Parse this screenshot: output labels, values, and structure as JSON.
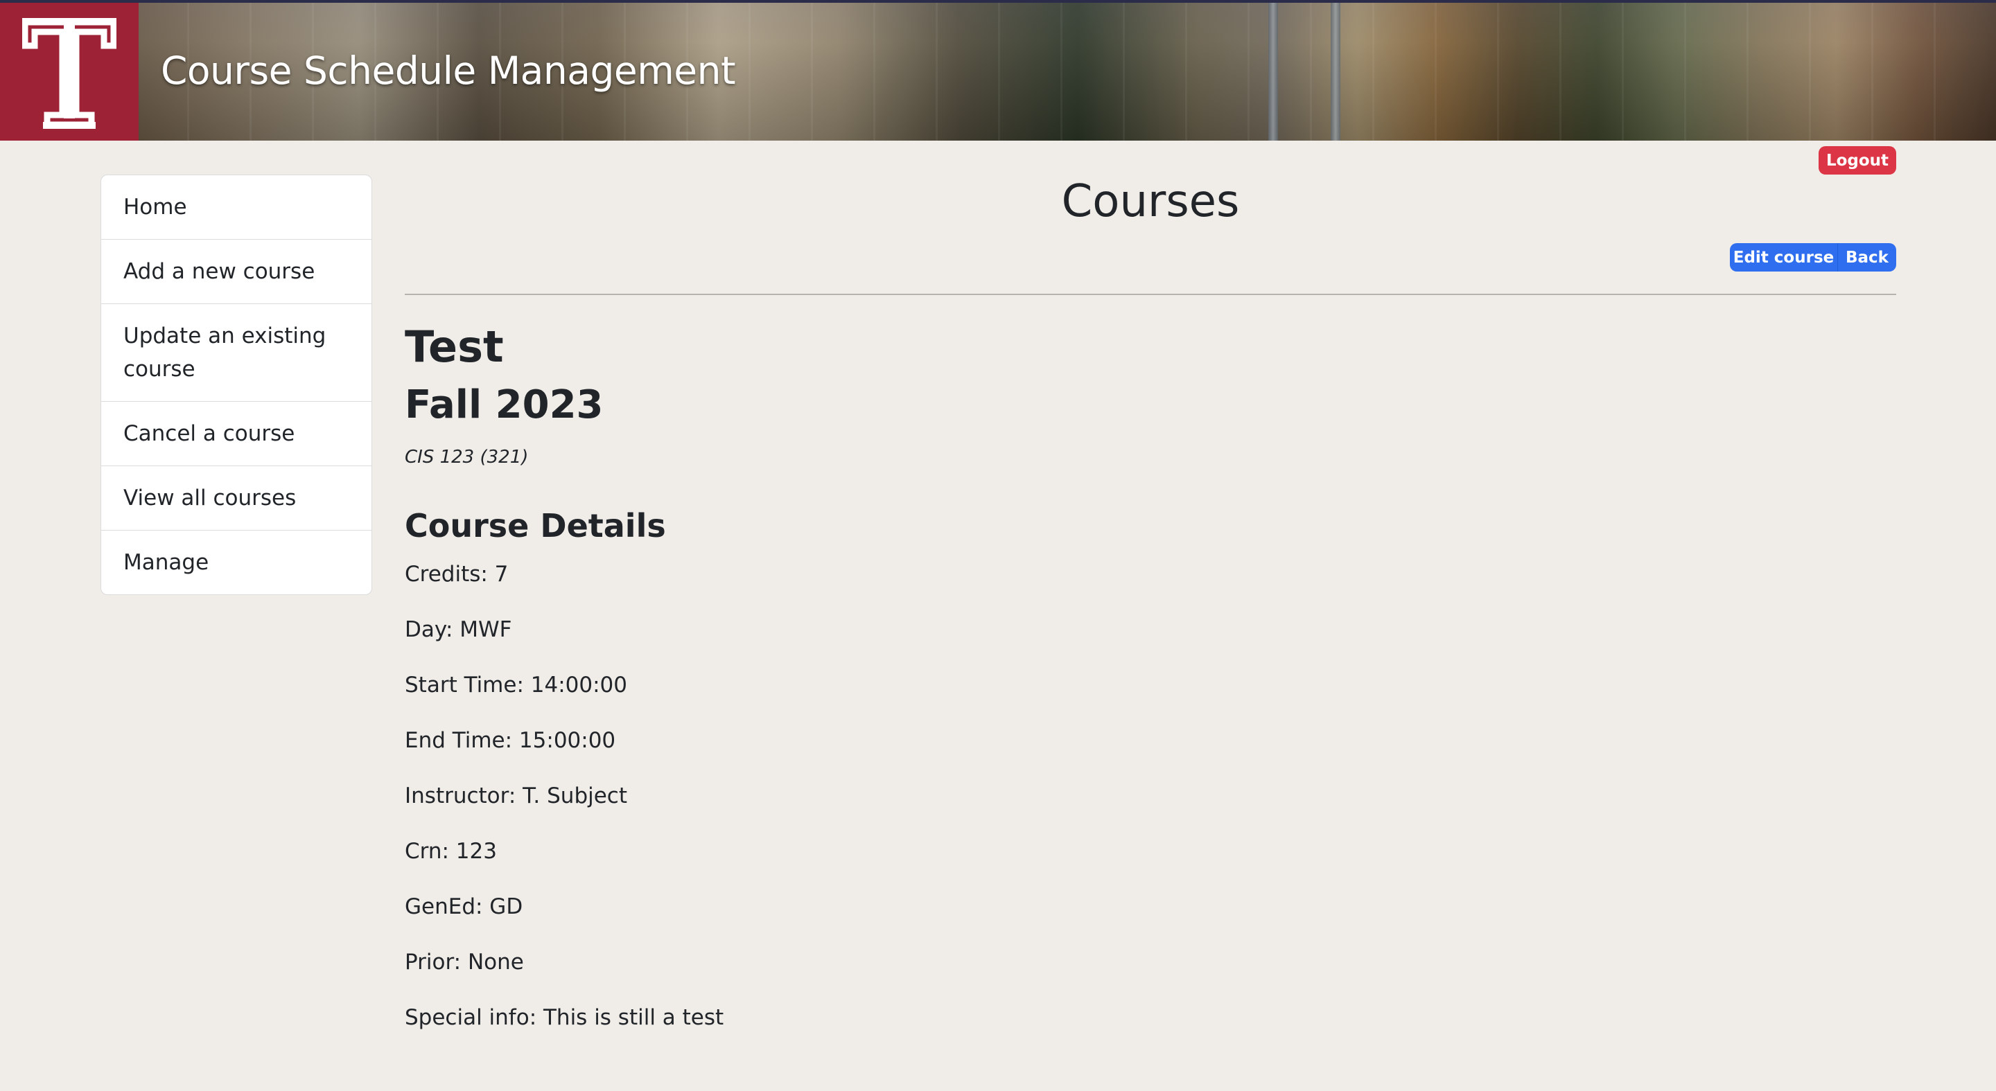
{
  "header": {
    "app_title": "Course Schedule Management",
    "logo_icon": "temple-t-logo-icon",
    "brand_color": "#9d2235"
  },
  "account": {
    "logout_label": "Logout",
    "logout_color": "#dc3545"
  },
  "sidebar": {
    "items": [
      {
        "label": "Home"
      },
      {
        "label": "Add a new course"
      },
      {
        "label": "Update an existing course"
      },
      {
        "label": "Cancel a course"
      },
      {
        "label": "View all courses"
      },
      {
        "label": "Manage"
      }
    ]
  },
  "main": {
    "page_title": "Courses",
    "actions": {
      "edit_label": "Edit course",
      "back_label": "Back",
      "button_color": "#2f6fef"
    },
    "course": {
      "name": "Test",
      "term": "Fall 2023",
      "code": "CIS 123 (321)",
      "details_heading": "Course Details",
      "details": [
        "Credits: 7",
        "Day: MWF",
        "Start Time: 14:00:00",
        "End Time: 15:00:00",
        "Instructor: T. Subject",
        "Crn: 123",
        "GenEd: GD",
        "Prior: None",
        "Special info: This is still a test"
      ]
    }
  }
}
